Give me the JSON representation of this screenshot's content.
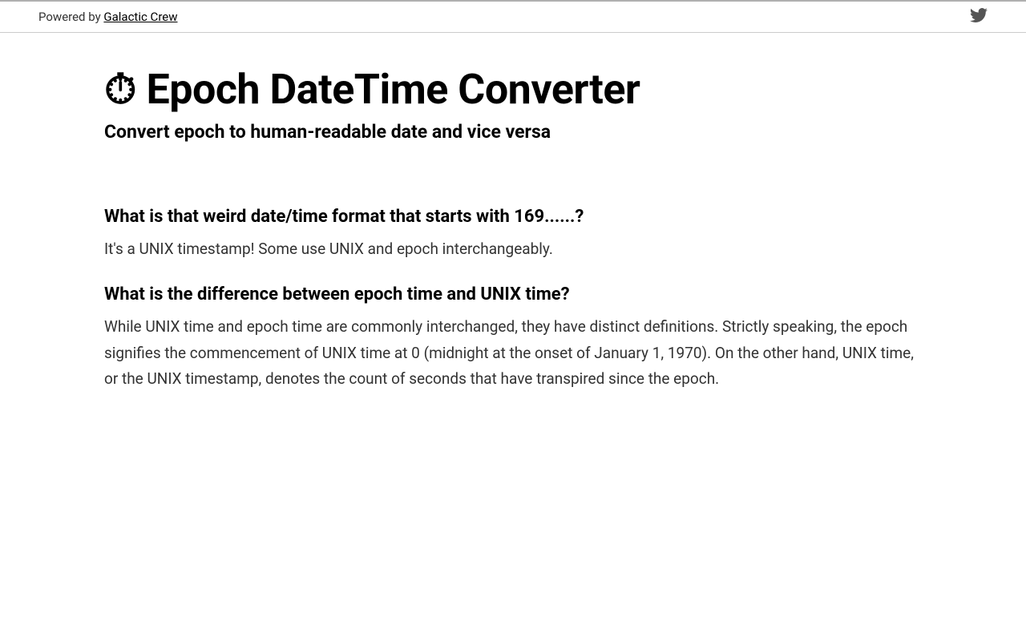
{
  "header": {
    "powered_by_prefix": "Powered by ",
    "powered_by_link": "Galactic Crew"
  },
  "main": {
    "title": "⏱ Epoch DateTime Converter",
    "subtitle": "Convert epoch to human-readable date and vice versa"
  },
  "faq": [
    {
      "question": "What is that weird date/time format that starts with 169......?",
      "answer": "It's a UNIX timestamp! Some use UNIX and epoch interchangeably."
    },
    {
      "question": "What is the difference between epoch time and UNIX time?",
      "answer": "While UNIX time and epoch time are commonly interchanged, they have distinct definitions. Strictly speaking, the epoch signifies the commencement of UNIX time at 0 (midnight at the onset of January 1, 1970). On the other hand, UNIX time, or the UNIX timestamp, denotes the count of seconds that have transpired since the epoch."
    }
  ]
}
